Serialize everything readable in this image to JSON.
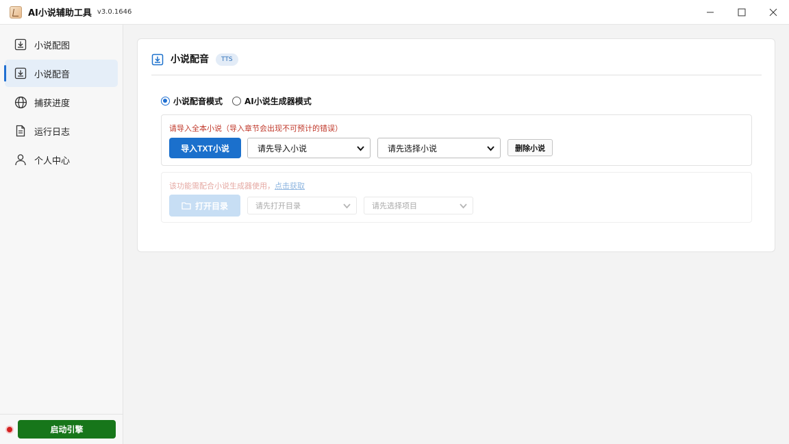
{
  "app": {
    "title": "AI小说辅助工具",
    "version": "v3.0.1646"
  },
  "window_controls": [
    "minimize-icon",
    "maximize-icon",
    "close-icon"
  ],
  "sidebar": {
    "items": [
      {
        "label": "小说配图",
        "icon": "download-box-icon",
        "active": false
      },
      {
        "label": "小说配音",
        "icon": "download-box-icon",
        "active": true
      },
      {
        "label": "捕获进度",
        "icon": "globe-icon",
        "active": false
      },
      {
        "label": "运行日志",
        "icon": "document-icon",
        "active": false
      },
      {
        "label": "个人中心",
        "icon": "person-icon",
        "active": false
      }
    ],
    "engine_button": "启动引擎",
    "engine_status_color": "#d42020"
  },
  "card": {
    "title": "小说配音",
    "badge": "TTS",
    "modes": [
      {
        "label": "小说配音模式",
        "checked": true
      },
      {
        "label": "AI小说生成器模式",
        "checked": false
      }
    ],
    "panel_a": {
      "warning": "请导入全本小说（导入章节会出现不可预计的错误）",
      "import_button": "导入TXT小说",
      "select_novel": "请先导入小说",
      "select_chapter": "请先选择小说",
      "delete_button": "删除小说"
    },
    "panel_b": {
      "hint": "该功能需配合小说生成器使用，",
      "hint_link": "点击获取",
      "open_dir_button": "打开目录",
      "select_dir": "请先打开目录",
      "select_project": "请先选择项目"
    }
  },
  "colors": {
    "accent": "#1b70cc",
    "engine": "#17761a",
    "warning": "#c0392b"
  }
}
